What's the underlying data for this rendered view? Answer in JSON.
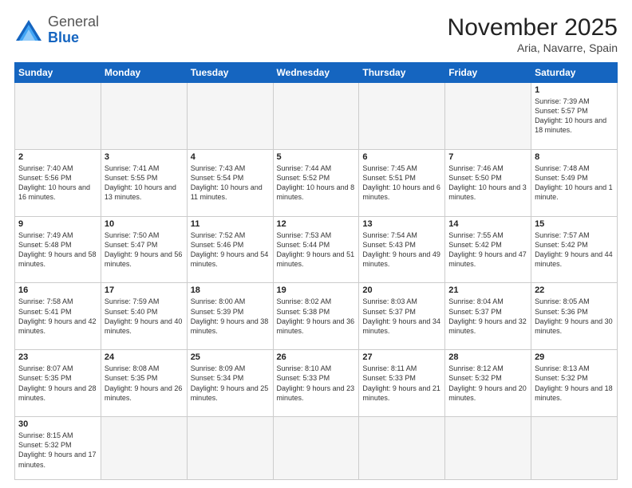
{
  "header": {
    "logo_general": "General",
    "logo_blue": "Blue",
    "month_year": "November 2025",
    "location": "Aria, Navarre, Spain"
  },
  "weekdays": [
    "Sunday",
    "Monday",
    "Tuesday",
    "Wednesday",
    "Thursday",
    "Friday",
    "Saturday"
  ],
  "weeks": [
    [
      {
        "day": "",
        "info": ""
      },
      {
        "day": "",
        "info": ""
      },
      {
        "day": "",
        "info": ""
      },
      {
        "day": "",
        "info": ""
      },
      {
        "day": "",
        "info": ""
      },
      {
        "day": "",
        "info": ""
      },
      {
        "day": "1",
        "info": "Sunrise: 7:39 AM\nSunset: 5:57 PM\nDaylight: 10 hours and 18 minutes."
      }
    ],
    [
      {
        "day": "2",
        "info": "Sunrise: 7:40 AM\nSunset: 5:56 PM\nDaylight: 10 hours and 16 minutes."
      },
      {
        "day": "3",
        "info": "Sunrise: 7:41 AM\nSunset: 5:55 PM\nDaylight: 10 hours and 13 minutes."
      },
      {
        "day": "4",
        "info": "Sunrise: 7:43 AM\nSunset: 5:54 PM\nDaylight: 10 hours and 11 minutes."
      },
      {
        "day": "5",
        "info": "Sunrise: 7:44 AM\nSunset: 5:52 PM\nDaylight: 10 hours and 8 minutes."
      },
      {
        "day": "6",
        "info": "Sunrise: 7:45 AM\nSunset: 5:51 PM\nDaylight: 10 hours and 6 minutes."
      },
      {
        "day": "7",
        "info": "Sunrise: 7:46 AM\nSunset: 5:50 PM\nDaylight: 10 hours and 3 minutes."
      },
      {
        "day": "8",
        "info": "Sunrise: 7:48 AM\nSunset: 5:49 PM\nDaylight: 10 hours and 1 minute."
      }
    ],
    [
      {
        "day": "9",
        "info": "Sunrise: 7:49 AM\nSunset: 5:48 PM\nDaylight: 9 hours and 58 minutes."
      },
      {
        "day": "10",
        "info": "Sunrise: 7:50 AM\nSunset: 5:47 PM\nDaylight: 9 hours and 56 minutes."
      },
      {
        "day": "11",
        "info": "Sunrise: 7:52 AM\nSunset: 5:46 PM\nDaylight: 9 hours and 54 minutes."
      },
      {
        "day": "12",
        "info": "Sunrise: 7:53 AM\nSunset: 5:44 PM\nDaylight: 9 hours and 51 minutes."
      },
      {
        "day": "13",
        "info": "Sunrise: 7:54 AM\nSunset: 5:43 PM\nDaylight: 9 hours and 49 minutes."
      },
      {
        "day": "14",
        "info": "Sunrise: 7:55 AM\nSunset: 5:42 PM\nDaylight: 9 hours and 47 minutes."
      },
      {
        "day": "15",
        "info": "Sunrise: 7:57 AM\nSunset: 5:42 PM\nDaylight: 9 hours and 44 minutes."
      }
    ],
    [
      {
        "day": "16",
        "info": "Sunrise: 7:58 AM\nSunset: 5:41 PM\nDaylight: 9 hours and 42 minutes."
      },
      {
        "day": "17",
        "info": "Sunrise: 7:59 AM\nSunset: 5:40 PM\nDaylight: 9 hours and 40 minutes."
      },
      {
        "day": "18",
        "info": "Sunrise: 8:00 AM\nSunset: 5:39 PM\nDaylight: 9 hours and 38 minutes."
      },
      {
        "day": "19",
        "info": "Sunrise: 8:02 AM\nSunset: 5:38 PM\nDaylight: 9 hours and 36 minutes."
      },
      {
        "day": "20",
        "info": "Sunrise: 8:03 AM\nSunset: 5:37 PM\nDaylight: 9 hours and 34 minutes."
      },
      {
        "day": "21",
        "info": "Sunrise: 8:04 AM\nSunset: 5:37 PM\nDaylight: 9 hours and 32 minutes."
      },
      {
        "day": "22",
        "info": "Sunrise: 8:05 AM\nSunset: 5:36 PM\nDaylight: 9 hours and 30 minutes."
      }
    ],
    [
      {
        "day": "23",
        "info": "Sunrise: 8:07 AM\nSunset: 5:35 PM\nDaylight: 9 hours and 28 minutes."
      },
      {
        "day": "24",
        "info": "Sunrise: 8:08 AM\nSunset: 5:35 PM\nDaylight: 9 hours and 26 minutes."
      },
      {
        "day": "25",
        "info": "Sunrise: 8:09 AM\nSunset: 5:34 PM\nDaylight: 9 hours and 25 minutes."
      },
      {
        "day": "26",
        "info": "Sunrise: 8:10 AM\nSunset: 5:33 PM\nDaylight: 9 hours and 23 minutes."
      },
      {
        "day": "27",
        "info": "Sunrise: 8:11 AM\nSunset: 5:33 PM\nDaylight: 9 hours and 21 minutes."
      },
      {
        "day": "28",
        "info": "Sunrise: 8:12 AM\nSunset: 5:32 PM\nDaylight: 9 hours and 20 minutes."
      },
      {
        "day": "29",
        "info": "Sunrise: 8:13 AM\nSunset: 5:32 PM\nDaylight: 9 hours and 18 minutes."
      }
    ],
    [
      {
        "day": "30",
        "info": "Sunrise: 8:15 AM\nSunset: 5:32 PM\nDaylight: 9 hours and 17 minutes."
      },
      {
        "day": "",
        "info": ""
      },
      {
        "day": "",
        "info": ""
      },
      {
        "day": "",
        "info": ""
      },
      {
        "day": "",
        "info": ""
      },
      {
        "day": "",
        "info": ""
      },
      {
        "day": "",
        "info": ""
      }
    ]
  ]
}
